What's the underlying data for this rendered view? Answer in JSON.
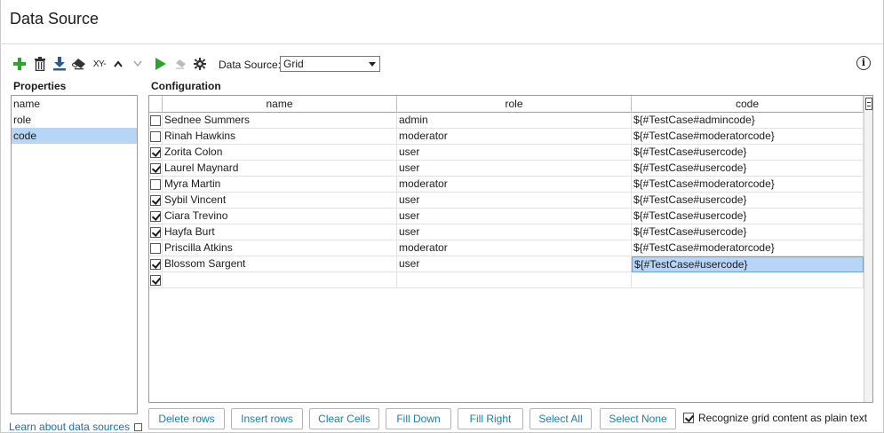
{
  "window": {
    "title": "Data Source"
  },
  "toolbar": {
    "xy_label": "XY-",
    "data_source_label": "Data Source:",
    "data_source_value": "Grid"
  },
  "properties": {
    "label": "Properties",
    "items": [
      {
        "label": "name",
        "selected": false
      },
      {
        "label": "role",
        "selected": false
      },
      {
        "label": "code",
        "selected": true
      }
    ]
  },
  "configuration": {
    "label": "Configuration",
    "columns": [
      "name",
      "role",
      "code"
    ],
    "rows": [
      {
        "checked": false,
        "name": "Sednee Summers",
        "role": "admin",
        "code": "${#TestCase#admincode}"
      },
      {
        "checked": false,
        "name": "Rinah Hawkins",
        "role": "moderator",
        "code": "${#TestCase#moderatorcode}"
      },
      {
        "checked": true,
        "name": "Zorita Colon",
        "role": "user",
        "code": "${#TestCase#usercode}"
      },
      {
        "checked": true,
        "name": "Laurel Maynard",
        "role": "user",
        "code": "${#TestCase#usercode}"
      },
      {
        "checked": false,
        "name": "Myra Martin",
        "role": "moderator",
        "code": "${#TestCase#moderatorcode}"
      },
      {
        "checked": true,
        "name": "Sybil Vincent",
        "role": "user",
        "code": "${#TestCase#usercode}"
      },
      {
        "checked": true,
        "name": "Ciara Trevino",
        "role": "user",
        "code": "${#TestCase#usercode}"
      },
      {
        "checked": true,
        "name": "Hayfa Burt",
        "role": "user",
        "code": "${#TestCase#usercode}"
      },
      {
        "checked": false,
        "name": "Priscilla Atkins",
        "role": "moderator",
        "code": "${#TestCase#moderatorcode}"
      },
      {
        "checked": true,
        "name": "Blossom Sargent",
        "role": "user",
        "code": "${#TestCase#usercode}",
        "selected_cell": "code"
      },
      {
        "checked": true,
        "name": "",
        "role": "",
        "code": ""
      }
    ]
  },
  "buttons": {
    "delete_rows": "Delete rows",
    "insert_rows": "Insert rows",
    "clear_cells": "Clear Cells",
    "fill_down": "Fill Down",
    "fill_right": "Fill Right",
    "select_all": "Select All",
    "select_none": "Select None"
  },
  "recognize_plain_text": {
    "label": "Recognize grid content as plain text",
    "checked": true
  },
  "learn_link": "Learn about data sources",
  "colors": {
    "accent": "#1b7ea8",
    "selection": "#b7d5f7",
    "run_green": "#2aa52a"
  }
}
